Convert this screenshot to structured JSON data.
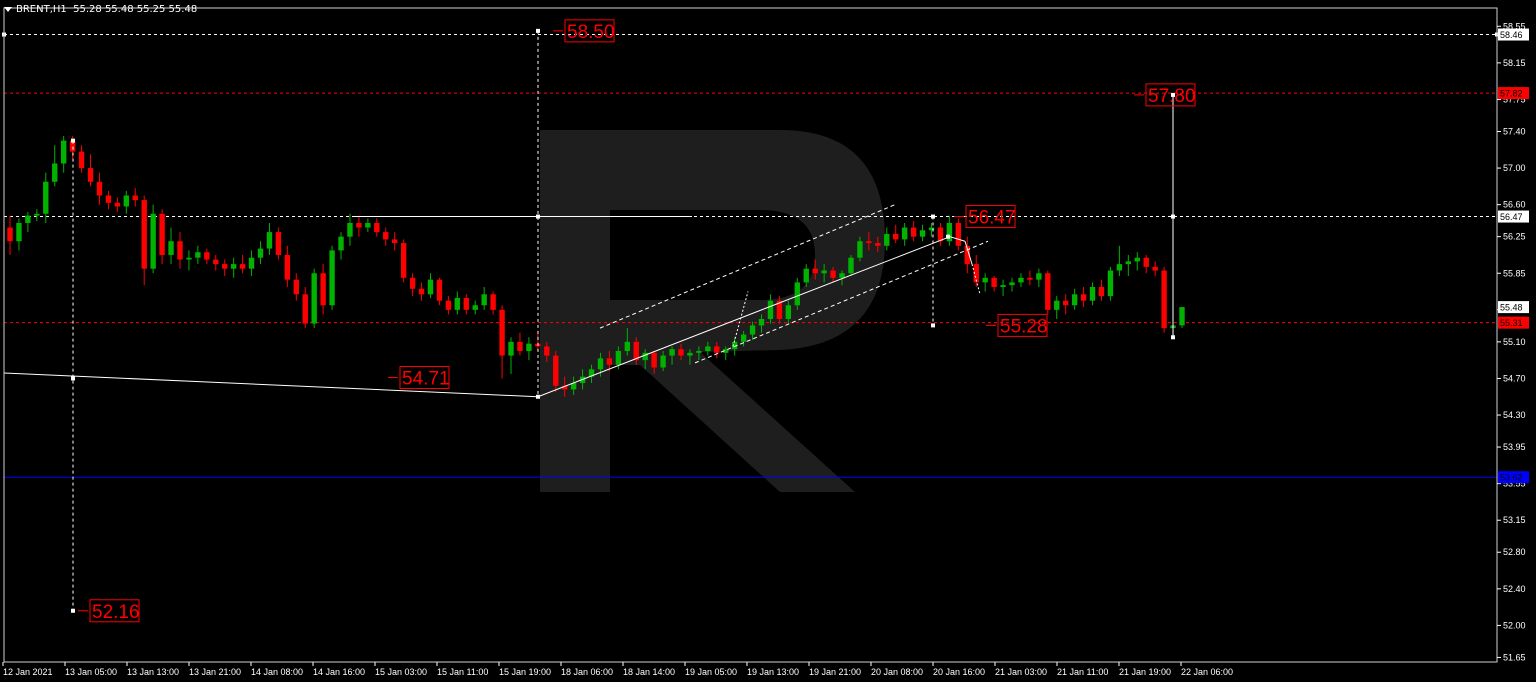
{
  "header": {
    "symbol": "BRENT,H1",
    "ohlc": "55.28 55.48 55.25 55.48"
  },
  "colors": {
    "background": "#000000",
    "bull": "#00b300",
    "bear": "#ff0000",
    "level": "#ff0000",
    "blue_level": "#0000ff",
    "axis_text": "#ffffff",
    "watermark": "#1e1e1e"
  },
  "chart_data": {
    "type": "candlestick",
    "symbol": "BRENT",
    "timeframe": "H1",
    "ylim": [
      51.6,
      58.75
    ],
    "y_ticks": [
      "58.55",
      "58.15",
      "57.75",
      "57.40",
      "57.00",
      "56.60",
      "56.25",
      "55.85",
      "55.45",
      "55.10",
      "54.70",
      "54.30",
      "53.95",
      "53.55",
      "53.15",
      "52.80",
      "52.40",
      "52.00",
      "51.65"
    ],
    "x_ticks": [
      "12 Jan 2021",
      "13 Jan 05:00",
      "13 Jan 13:00",
      "13 Jan 21:00",
      "14 Jan 08:00",
      "14 Jan 16:00",
      "15 Jan 03:00",
      "15 Jan 11:00",
      "15 Jan 19:00",
      "18 Jan 06:00",
      "18 Jan 14:00",
      "19 Jan 05:00",
      "19 Jan 13:00",
      "19 Jan 21:00",
      "20 Jan 08:00",
      "20 Jan 16:00",
      "21 Jan 03:00",
      "21 Jan 11:00",
      "21 Jan 19:00",
      "22 Jan 06:00"
    ],
    "axis_badges": [
      {
        "value": 58.46,
        "label": "58.46",
        "color": "#ffffff",
        "text_color": "#000000"
      },
      {
        "value": 57.82,
        "label": "57.82",
        "color": "#ff0000",
        "text_color": "#000000"
      },
      {
        "value": 56.47,
        "label": "56.47",
        "color": "#ffffff",
        "text_color": "#000000"
      },
      {
        "value": 55.48,
        "label": "55.48",
        "color": "#ffffff",
        "text_color": "#000000"
      },
      {
        "value": 55.31,
        "label": "55.31",
        "color": "#ff0000",
        "text_color": "#000000"
      },
      {
        "value": 53.62,
        "label": "53.62",
        "color": "#0000ff",
        "text_color": "#000000"
      }
    ],
    "horizontal_levels": [
      {
        "value": 58.46,
        "style": "dashed",
        "color": "#ffffff"
      },
      {
        "value": 57.82,
        "style": "dashed",
        "color": "#ff0000"
      },
      {
        "value": 56.47,
        "style": "dashed",
        "color": "#ffffff"
      },
      {
        "value": 55.31,
        "style": "dashed",
        "color": "#ff0000"
      },
      {
        "value": 53.62,
        "style": "solid",
        "color": "#0000ff"
      }
    ],
    "annotations": [
      {
        "label": "58.50",
        "value": 58.5
      },
      {
        "label": "57.80",
        "value": 57.8
      },
      {
        "label": "56.47",
        "value": 56.47
      },
      {
        "label": "55.28",
        "value": 55.28
      },
      {
        "label": "54.71",
        "value": 54.71
      },
      {
        "label": "52.16",
        "value": 52.16
      }
    ],
    "candles": [
      [
        56.35,
        56.48,
        56.05,
        56.2
      ],
      [
        56.2,
        56.45,
        56.1,
        56.4
      ],
      [
        56.4,
        56.52,
        56.3,
        56.48
      ],
      [
        56.48,
        56.55,
        56.42,
        56.5
      ],
      [
        56.5,
        56.95,
        56.4,
        56.85
      ],
      [
        56.85,
        57.25,
        56.8,
        57.05
      ],
      [
        57.05,
        57.35,
        56.95,
        57.3
      ],
      [
        57.3,
        57.35,
        57.1,
        57.18
      ],
      [
        57.18,
        57.25,
        56.95,
        57.0
      ],
      [
        57.0,
        57.15,
        56.8,
        56.85
      ],
      [
        56.85,
        56.95,
        56.6,
        56.7
      ],
      [
        56.7,
        56.75,
        56.55,
        56.62
      ],
      [
        56.62,
        56.68,
        56.52,
        56.58
      ],
      [
        56.58,
        56.75,
        56.5,
        56.7
      ],
      [
        56.7,
        56.78,
        56.58,
        56.65
      ],
      [
        56.65,
        56.7,
        55.72,
        55.9
      ],
      [
        55.9,
        56.6,
        55.85,
        56.5
      ],
      [
        56.5,
        56.55,
        55.95,
        56.05
      ],
      [
        56.05,
        56.35,
        55.95,
        56.2
      ],
      [
        56.2,
        56.3,
        55.9,
        56.0
      ],
      [
        56.0,
        56.1,
        55.88,
        56.02
      ],
      [
        56.02,
        56.15,
        55.95,
        56.08
      ],
      [
        56.08,
        56.12,
        55.95,
        56.0
      ],
      [
        56.0,
        56.05,
        55.88,
        55.95
      ],
      [
        55.95,
        56.0,
        55.82,
        55.9
      ],
      [
        55.9,
        56.02,
        55.8,
        55.95
      ],
      [
        55.95,
        56.05,
        55.85,
        55.9
      ],
      [
        55.9,
        56.1,
        55.82,
        56.02
      ],
      [
        56.02,
        56.2,
        55.95,
        56.12
      ],
      [
        56.12,
        56.4,
        56.05,
        56.3
      ],
      [
        56.3,
        56.35,
        56.0,
        56.05
      ],
      [
        56.05,
        56.15,
        55.7,
        55.78
      ],
      [
        55.78,
        55.85,
        55.55,
        55.62
      ],
      [
        55.62,
        55.7,
        55.25,
        55.3
      ],
      [
        55.3,
        55.9,
        55.25,
        55.85
      ],
      [
        55.85,
        55.95,
        55.4,
        55.5
      ],
      [
        55.5,
        56.15,
        55.45,
        56.1
      ],
      [
        56.1,
        56.3,
        56.0,
        56.25
      ],
      [
        56.25,
        56.5,
        56.15,
        56.4
      ],
      [
        56.4,
        56.48,
        56.25,
        56.35
      ],
      [
        56.35,
        56.45,
        56.3,
        56.4
      ],
      [
        56.4,
        56.45,
        56.25,
        56.3
      ],
      [
        56.3,
        56.35,
        56.15,
        56.22
      ],
      [
        56.22,
        56.3,
        56.1,
        56.18
      ],
      [
        56.18,
        56.22,
        55.75,
        55.8
      ],
      [
        55.8,
        55.85,
        55.6,
        55.68
      ],
      [
        55.68,
        55.75,
        55.55,
        55.62
      ],
      [
        55.62,
        55.85,
        55.58,
        55.78
      ],
      [
        55.78,
        55.8,
        55.5,
        55.55
      ],
      [
        55.55,
        55.6,
        55.4,
        55.45
      ],
      [
        55.45,
        55.65,
        55.4,
        55.58
      ],
      [
        55.58,
        55.62,
        55.4,
        55.45
      ],
      [
        55.45,
        55.55,
        55.4,
        55.5
      ],
      [
        55.5,
        55.7,
        55.45,
        55.62
      ],
      [
        55.62,
        55.65,
        55.4,
        55.45
      ],
      [
        55.45,
        55.5,
        54.7,
        54.95
      ],
      [
        54.95,
        55.15,
        54.75,
        55.1
      ],
      [
        55.1,
        55.2,
        54.95,
        55.0
      ],
      [
        55.0,
        55.15,
        54.9,
        55.08
      ],
      [
        55.08,
        55.2,
        55.0,
        55.05
      ],
      [
        55.05,
        55.1,
        54.88,
        54.95
      ],
      [
        54.95,
        55.0,
        54.55,
        54.62
      ],
      [
        54.62,
        54.72,
        54.5,
        54.58
      ],
      [
        54.58,
        54.72,
        54.52,
        54.65
      ],
      [
        54.65,
        54.8,
        54.58,
        54.72
      ],
      [
        54.72,
        54.85,
        54.65,
        54.8
      ],
      [
        54.8,
        54.98,
        54.72,
        54.92
      ],
      [
        54.92,
        55.0,
        54.78,
        54.85
      ],
      [
        54.85,
        55.05,
        54.8,
        55.0
      ],
      [
        55.0,
        55.25,
        54.95,
        55.1
      ],
      [
        55.1,
        55.15,
        54.85,
        54.9
      ],
      [
        54.9,
        55.02,
        54.8,
        54.98
      ],
      [
        54.98,
        55.0,
        54.75,
        54.82
      ],
      [
        54.82,
        55.0,
        54.78,
        54.95
      ],
      [
        54.95,
        55.05,
        54.85,
        55.02
      ],
      [
        55.02,
        55.08,
        54.9,
        54.95
      ],
      [
        54.95,
        55.02,
        54.85,
        54.98
      ],
      [
        54.98,
        55.05,
        54.9,
        55.0
      ],
      [
        55.0,
        55.1,
        54.95,
        55.05
      ],
      [
        55.05,
        55.1,
        54.92,
        54.98
      ],
      [
        54.98,
        55.05,
        54.9,
        55.02
      ],
      [
        55.02,
        55.15,
        54.95,
        55.1
      ],
      [
        55.1,
        55.22,
        55.05,
        55.18
      ],
      [
        55.18,
        55.32,
        55.12,
        55.28
      ],
      [
        55.28,
        55.4,
        55.2,
        55.35
      ],
      [
        55.35,
        55.62,
        55.3,
        55.55
      ],
      [
        55.55,
        55.6,
        55.3,
        55.35
      ],
      [
        55.35,
        55.55,
        55.3,
        55.5
      ],
      [
        55.5,
        55.8,
        55.45,
        55.75
      ],
      [
        55.75,
        55.95,
        55.7,
        55.9
      ],
      [
        55.9,
        56.0,
        55.78,
        55.85
      ],
      [
        55.85,
        55.95,
        55.75,
        55.88
      ],
      [
        55.88,
        55.92,
        55.75,
        55.8
      ],
      [
        55.8,
        55.88,
        55.72,
        55.85
      ],
      [
        55.85,
        56.05,
        55.82,
        56.02
      ],
      [
        56.02,
        56.25,
        55.98,
        56.2
      ],
      [
        56.2,
        56.3,
        56.1,
        56.18
      ],
      [
        56.18,
        56.25,
        56.08,
        56.15
      ],
      [
        56.15,
        56.35,
        56.1,
        56.28
      ],
      [
        56.28,
        56.38,
        56.18,
        56.22
      ],
      [
        56.22,
        56.4,
        56.15,
        56.35
      ],
      [
        56.35,
        56.42,
        56.2,
        56.25
      ],
      [
        56.25,
        56.38,
        56.2,
        56.32
      ],
      [
        56.32,
        56.4,
        56.25,
        56.35
      ],
      [
        56.35,
        56.4,
        56.15,
        56.2
      ],
      [
        56.2,
        56.48,
        56.15,
        56.4
      ],
      [
        56.4,
        56.45,
        56.1,
        56.15
      ],
      [
        56.15,
        56.25,
        55.85,
        55.95
      ],
      [
        55.95,
        56.05,
        55.7,
        55.75
      ],
      [
        55.75,
        55.85,
        55.65,
        55.8
      ],
      [
        55.8,
        55.82,
        55.65,
        55.7
      ],
      [
        55.7,
        55.78,
        55.6,
        55.72
      ],
      [
        55.72,
        55.8,
        55.65,
        55.75
      ],
      [
        55.75,
        55.85,
        55.7,
        55.8
      ],
      [
        55.8,
        55.88,
        55.72,
        55.78
      ],
      [
        55.78,
        55.9,
        55.7,
        55.85
      ],
      [
        55.85,
        55.88,
        55.4,
        55.45
      ],
      [
        55.45,
        55.6,
        55.35,
        55.55
      ],
      [
        55.55,
        55.62,
        55.4,
        55.5
      ],
      [
        55.5,
        55.68,
        55.45,
        55.62
      ],
      [
        55.62,
        55.7,
        55.48,
        55.55
      ],
      [
        55.55,
        55.75,
        55.5,
        55.7
      ],
      [
        55.7,
        55.78,
        55.55,
        55.6
      ],
      [
        55.6,
        55.92,
        55.55,
        55.88
      ],
      [
        55.88,
        56.15,
        55.82,
        55.95
      ],
      [
        55.95,
        56.05,
        55.82,
        55.98
      ],
      [
        55.98,
        56.08,
        55.88,
        56.02
      ],
      [
        56.02,
        56.05,
        55.85,
        55.92
      ],
      [
        55.92,
        55.98,
        55.82,
        55.88
      ],
      [
        55.88,
        55.92,
        55.2,
        55.25
      ],
      [
        55.25,
        55.35,
        55.15,
        55.28
      ],
      [
        55.28,
        55.48,
        55.25,
        55.48
      ]
    ]
  }
}
